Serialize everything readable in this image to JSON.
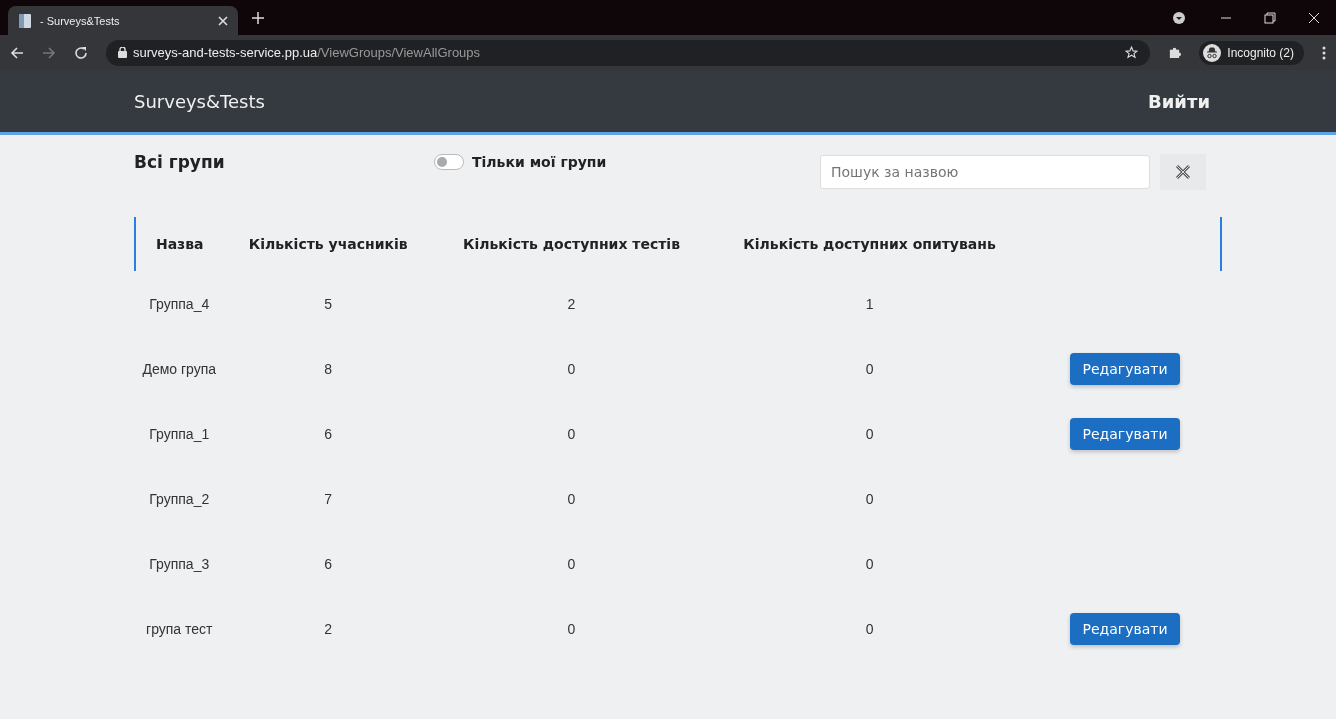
{
  "browser": {
    "tab_title": "- Surveys&Tests",
    "url_host": "surveys-and-tests-service.pp.ua",
    "url_path": "/ViewGroups/ViewAllGroups",
    "profile": "Incognito (2)"
  },
  "navbar": {
    "brand": "Surveys&Tests",
    "logout": "Вийти"
  },
  "toolbar": {
    "title": "Всі групи",
    "toggle": {
      "label": "Тільки мої групи",
      "on": false
    },
    "search": {
      "placeholder": "Пошук за назвою"
    }
  },
  "table": {
    "columns": [
      "Назва",
      "Кількість учасників",
      "Кількість доступних тестів",
      "Кількість доступних опитувань"
    ],
    "rows": [
      {
        "cells": [
          "Группа_4",
          "5",
          "2",
          "1"
        ],
        "action": null
      },
      {
        "cells": [
          "Демо група",
          "8",
          "0",
          "0"
        ],
        "action": "Редагувати"
      },
      {
        "cells": [
          "Группа_1",
          "6",
          "0",
          "0"
        ],
        "action": "Редагувати"
      },
      {
        "cells": [
          "Группа_2",
          "7",
          "0",
          "0"
        ],
        "action": null
      },
      {
        "cells": [
          "Группа_3",
          "6",
          "0",
          "0"
        ],
        "action": null
      },
      {
        "cells": [
          "група тест",
          "2",
          "0",
          "0"
        ],
        "action": "Редагувати"
      }
    ]
  }
}
